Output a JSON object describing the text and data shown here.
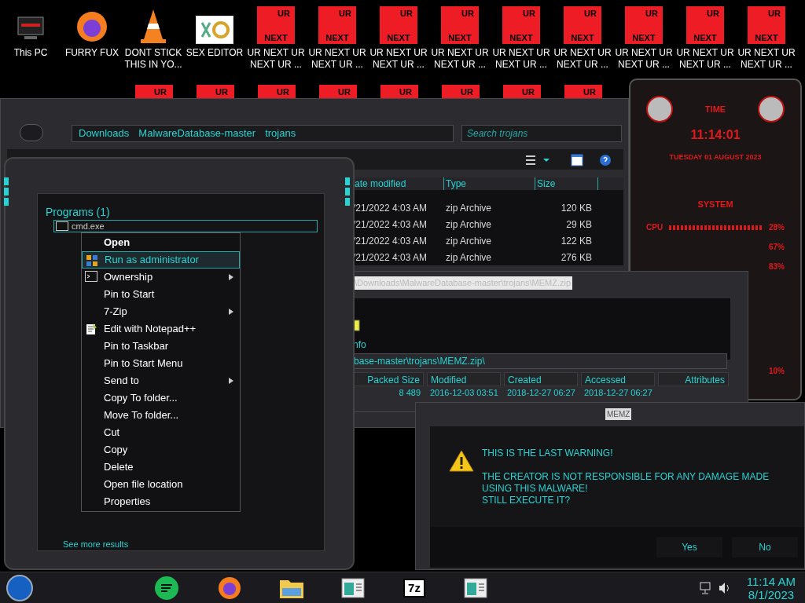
{
  "desktop_icons": [
    {
      "label": "This PC",
      "kind": "pc"
    },
    {
      "label": "FURRY FUX",
      "kind": "browser"
    },
    {
      "label": "DONT STICK THIS IN YO...",
      "kind": "cone"
    },
    {
      "label": "SEX EDITOR",
      "kind": "hex"
    },
    {
      "label": "UR NEXT UR NEXT UR ...",
      "kind": "tile",
      "tile_top": "UR",
      "tile_bottom": "NEXT"
    },
    {
      "label": "UR NEXT UR NEXT UR ...",
      "kind": "tile",
      "tile_top": "UR",
      "tile_bottom": "NEXT"
    },
    {
      "label": "UR NEXT UR NEXT UR ...",
      "kind": "tile",
      "tile_top": "UR",
      "tile_bottom": "NEXT"
    },
    {
      "label": "UR NEXT UR NEXT UR ...",
      "kind": "tile",
      "tile_top": "UR",
      "tile_bottom": "NEXT"
    },
    {
      "label": "UR NEXT UR NEXT UR ...",
      "kind": "tile",
      "tile_top": "UR",
      "tile_bottom": "NEXT"
    },
    {
      "label": "UR NEXT UR NEXT UR ...",
      "kind": "tile",
      "tile_top": "UR",
      "tile_bottom": "NEXT"
    },
    {
      "label": "UR NEXT UR NEXT UR ...",
      "kind": "tile",
      "tile_top": "UR",
      "tile_bottom": "NEXT"
    },
    {
      "label": "UR NEXT UR NEXT UR ...",
      "kind": "tile",
      "tile_top": "UR",
      "tile_bottom": "NEXT"
    },
    {
      "label": "UR NEXT UR NEXT UR ...",
      "kind": "tile",
      "tile_top": "UR",
      "tile_bottom": "NEXT"
    }
  ],
  "desktop_row2": [
    "UR",
    "UR",
    "UR",
    "UR",
    "UR",
    "UR",
    "UR",
    "UR"
  ],
  "explorer": {
    "breadcrumb": [
      "Downloads",
      "MalwareDatabase-master",
      "trojans"
    ],
    "search_placeholder": "Search trojans",
    "columns": [
      "ate modified",
      "Type",
      "Size"
    ],
    "rows": [
      {
        "modified": "/21/2022 4:03 AM",
        "type": "zip Archive",
        "size": "120 KB"
      },
      {
        "modified": "/21/2022 4:03 AM",
        "type": "zip Archive",
        "size": "29 KB"
      },
      {
        "modified": "/21/2022 4:03 AM",
        "type": "zip Archive",
        "size": "122 KB"
      },
      {
        "modified": "/21/2022 4:03 AM",
        "type": "zip Archive",
        "size": "276 KB"
      }
    ]
  },
  "start_menu": {
    "group": "Programs (1)",
    "result": "cmd.exe",
    "more": "See more results"
  },
  "context_menu": {
    "items": [
      {
        "label": "Open",
        "kind": "default",
        "submenu": false,
        "selected": false
      },
      {
        "label": "Run as administrator",
        "kind": "shield",
        "submenu": false,
        "selected": true
      },
      {
        "label": "Ownership",
        "kind": "console",
        "submenu": true,
        "selected": false
      },
      {
        "label": "Pin to Start",
        "kind": "plain",
        "submenu": false,
        "selected": false
      },
      {
        "label": "7-Zip",
        "kind": "plain",
        "submenu": true,
        "selected": false
      },
      {
        "label": "Edit with Notepad++",
        "kind": "notepad",
        "submenu": false,
        "selected": false
      },
      {
        "label": "Pin to Taskbar",
        "kind": "plain",
        "submenu": false,
        "selected": false
      },
      {
        "label": "Pin to Start Menu",
        "kind": "plain",
        "submenu": false,
        "selected": false
      },
      {
        "label": "Send to",
        "kind": "plain",
        "submenu": true,
        "selected": false
      },
      {
        "label": "Copy To folder...",
        "kind": "plain",
        "submenu": false,
        "selected": false
      },
      {
        "label": "Move To folder...",
        "kind": "plain",
        "submenu": false,
        "selected": false
      },
      {
        "label": "Cut",
        "kind": "plain",
        "submenu": false,
        "selected": false
      },
      {
        "label": "Copy",
        "kind": "plain",
        "submenu": false,
        "selected": false
      },
      {
        "label": "Delete",
        "kind": "plain",
        "submenu": false,
        "selected": false
      },
      {
        "label": "Open file location",
        "kind": "plain",
        "submenu": false,
        "selected": false
      },
      {
        "label": "Properties",
        "kind": "plain",
        "submenu": false,
        "selected": false
      }
    ]
  },
  "archiver": {
    "title": "\\Downloads\\MalwareDatabase-master\\trojans\\MEMZ.zip",
    "toolbar_label": "nfo",
    "address": "base-master\\trojans\\MEMZ.zip\\",
    "columns": [
      "Packed Size",
      "Modified",
      "Created",
      "Accessed",
      "Attributes"
    ],
    "row": [
      "8 489",
      "2016-12-03 03:51",
      "2018-12-27 06:27",
      "2018-12-27 06:27"
    ]
  },
  "dialog": {
    "title": "MEMZ",
    "lines": [
      "THIS IS THE LAST WARNING!",
      "THE CREATOR IS NOT RESPONSIBLE FOR ANY DAMAGE MADE USING THIS MALWARE!",
      "STILL EXECUTE IT?"
    ],
    "buttons": [
      "Yes",
      "No"
    ]
  },
  "widget": {
    "time_title": "TIME",
    "time": "11:14:01",
    "date": "TUESDAY 01 AUGUST 2023",
    "system_title": "SYSTEM",
    "cpu_label": "CPU",
    "readings": [
      "28%",
      "67%",
      "83%",
      "10%"
    ]
  },
  "taskbar": {
    "apps": [
      {
        "kind": "chat"
      },
      {
        "kind": "browser"
      },
      {
        "kind": "folder"
      },
      {
        "kind": "window"
      },
      {
        "kind": "zip",
        "label": "7z"
      },
      {
        "kind": "window"
      }
    ],
    "time": "11:14 AM",
    "date": "8/1/2023"
  }
}
